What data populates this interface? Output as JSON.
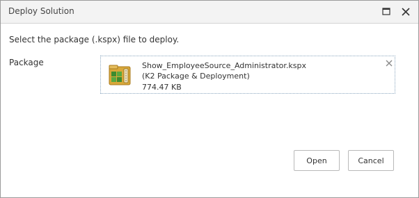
{
  "window": {
    "title": "Deploy Solution",
    "maximize_icon": "maximize-icon",
    "close_icon": "close-icon"
  },
  "content": {
    "instruction": "Select the package (.kspx) file to deploy.",
    "package_label": "Package"
  },
  "file": {
    "icon": "package-file-icon",
    "name": "Show_EmployeeSource_Administrator.kspx",
    "type": "(K2 Package & Deployment)",
    "size": "774.47 KB",
    "remove_icon": "remove-icon"
  },
  "buttons": {
    "open_label": "Open",
    "cancel_label": "Cancel"
  },
  "colors": {
    "titlebar_bg": "#f3f3f3",
    "file_box_border": "#8aa6bf",
    "icon_folder": "#d9a83a",
    "icon_green": "#3d8b2f"
  }
}
